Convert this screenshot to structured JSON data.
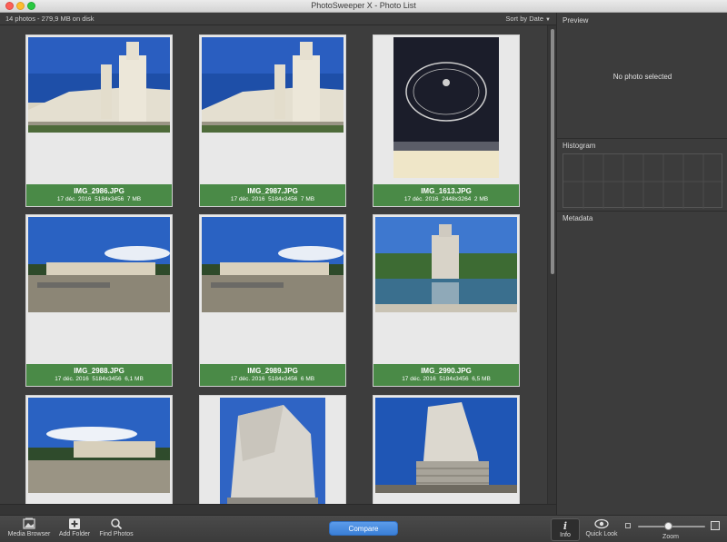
{
  "window": {
    "title": "PhotoSweeper X - Photo List"
  },
  "infobar": {
    "count": "14 photos - 279,9 MB on disk",
    "sort": "Sort by Date"
  },
  "photos": [
    {
      "name": "IMG_2986.JPG",
      "date": "17 déc. 2016",
      "dims": "5184x3456",
      "size": "7 MB"
    },
    {
      "name": "IMG_2987.JPG",
      "date": "17 déc. 2016",
      "dims": "5184x3456",
      "size": "7 MB"
    },
    {
      "name": "IMG_1613.JPG",
      "date": "17 déc. 2016",
      "dims": "2448x3264",
      "size": "2 MB"
    },
    {
      "name": "IMG_2988.JPG",
      "date": "17 déc. 2016",
      "dims": "5184x3456",
      "size": "6,1 MB"
    },
    {
      "name": "IMG_2989.JPG",
      "date": "17 déc. 2016",
      "dims": "5184x3456",
      "size": "6 MB"
    },
    {
      "name": "IMG_2990.JPG",
      "date": "17 déc. 2016",
      "dims": "5184x3456",
      "size": "6,5 MB"
    }
  ],
  "panel": {
    "preview": "Preview",
    "no_photo": "No photo selected",
    "histogram": "Histogram",
    "metadata": "Metadata"
  },
  "toolbar": {
    "media_browser": "Media Browser",
    "add_folder": "Add Folder",
    "find_photos": "Find Photos",
    "compare": "Compare",
    "info": "Info",
    "info_glyph": "i",
    "quick_look": "Quick Look",
    "zoom": "Zoom"
  },
  "colors": {
    "caption_green": "#4a8a47",
    "compare_blue": "#3a7fd7"
  },
  "icons": [
    "media-browser-icon",
    "add-folder-icon",
    "find-photos-icon",
    "info-icon",
    "quick-look-icon"
  ],
  "zoom_level": 0.45
}
